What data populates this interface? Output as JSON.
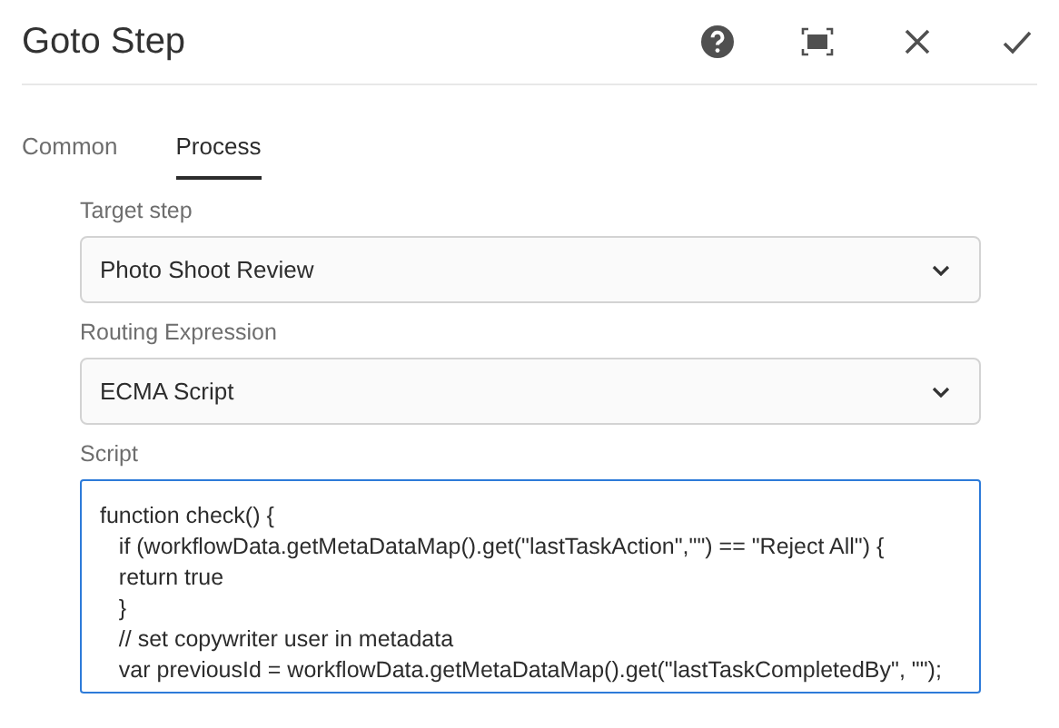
{
  "dialog": {
    "title": "Goto Step"
  },
  "tabs": [
    {
      "label": "Common",
      "selected": false
    },
    {
      "label": "Process",
      "selected": true
    }
  ],
  "fields": [
    {
      "kind": "select",
      "label": "Target step",
      "value": "Photo Shoot Review"
    },
    {
      "kind": "select",
      "label": "Routing Expression",
      "value": "ECMA Script"
    },
    {
      "kind": "code",
      "label": "Script",
      "focused": true,
      "lines": [
        "function check() {",
        "   if (workflowData.getMetaDataMap().get(\"lastTaskAction\",\"\") == \"Reject All\") {",
        "   return true",
        "   }",
        "   // set copywriter user in metadata",
        "   var previousId = workflowData.getMetaDataMap().get(\"lastTaskCompletedBy\", \"\");"
      ]
    }
  ]
}
